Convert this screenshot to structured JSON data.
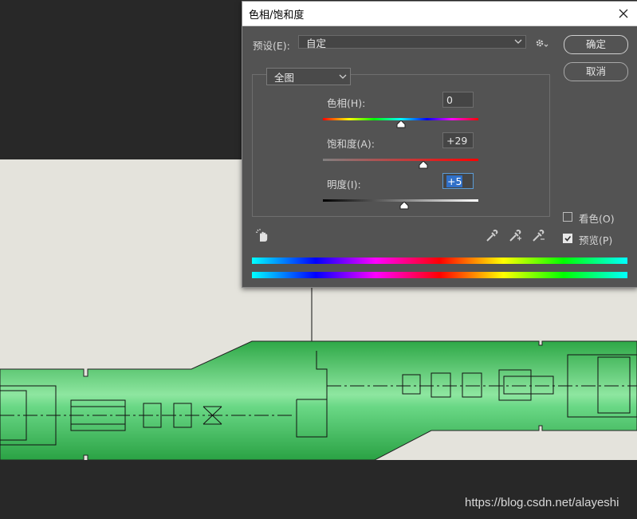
{
  "dialog": {
    "title": "色相/饱和度",
    "preset_label": "预设(E):",
    "preset_value": "自定",
    "ok_label": "确定",
    "cancel_label": "取消",
    "channel_value": "全图",
    "hue": {
      "label": "色相(H):",
      "value": "0",
      "level": 0.5
    },
    "saturation": {
      "label": "饱和度(A):",
      "value": "+29",
      "level": 0.645
    },
    "lightness": {
      "label": "明度(I):",
      "value": "+5",
      "level": 0.525
    },
    "colorize_label": "看色(O)",
    "colorize_checked": false,
    "preview_label": "预览(P)",
    "preview_checked": true
  },
  "watermark": "https://blog.csdn.net/alayeshi",
  "icons": [
    "close-icon",
    "gear-icon",
    "chevron-down-icon",
    "hand-target-icon",
    "eyedropper-icon",
    "eyedropper-plus-icon",
    "eyedropper-minus-icon",
    "checkmark-icon"
  ],
  "colors": {
    "dialog_bg": "#535353",
    "canvas_bg": "#282828",
    "drawing_bg": "#e4e3dc",
    "shaft_green": "#3cb054",
    "selection_blue": "#3070c8"
  }
}
